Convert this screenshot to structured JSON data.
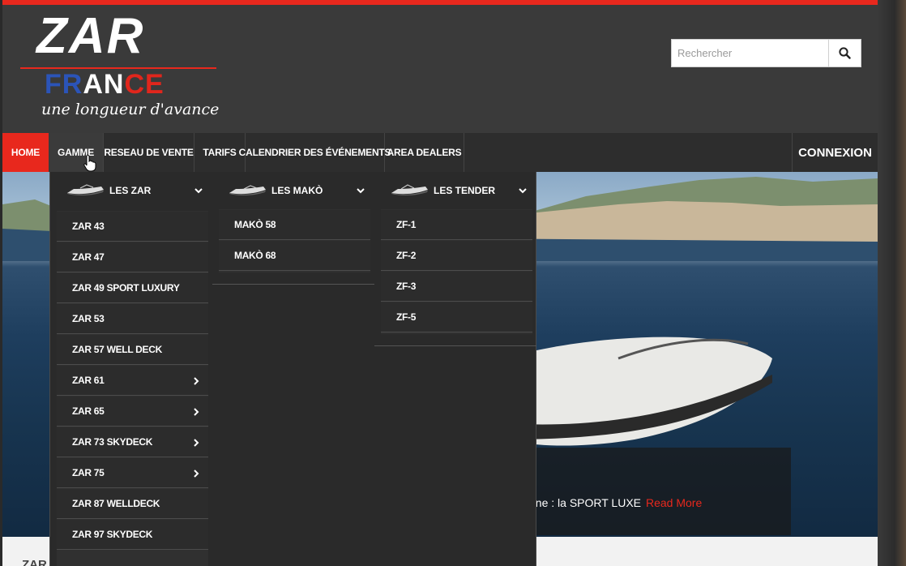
{
  "logo": {
    "zar": "ZAR",
    "france_parts": [
      "FR",
      "AN",
      "CE"
    ],
    "tagline": "une longueur d'avance"
  },
  "search": {
    "placeholder": "Rechercher",
    "icon": "search-icon"
  },
  "nav": {
    "items": [
      "HOME",
      "GAMME",
      "RESEAU DE VENTE",
      "TARIFS",
      "CALENDRIER DES ÉVÉNEMENTS",
      "AREA DEALERS"
    ],
    "login": "CONNEXION",
    "active_color": "#e8281d"
  },
  "mega": {
    "columns": [
      {
        "heading": "LES ZAR",
        "items": [
          {
            "label": "ZAR 43",
            "has_submenu": false
          },
          {
            "label": "ZAR 47",
            "has_submenu": false
          },
          {
            "label": "ZAR 49 SPORT LUXURY",
            "has_submenu": false
          },
          {
            "label": "ZAR 53",
            "has_submenu": false
          },
          {
            "label": "ZAR 57 WELL DECK",
            "has_submenu": false
          },
          {
            "label": "ZAR 61",
            "has_submenu": true
          },
          {
            "label": "ZAR 65",
            "has_submenu": true
          },
          {
            "label": "ZAR 73 SKYDECK",
            "has_submenu": true
          },
          {
            "label": "ZAR 75",
            "has_submenu": true
          },
          {
            "label": "ZAR 87 WELLDECK",
            "has_submenu": false
          },
          {
            "label": "ZAR 97 SKYDECK",
            "has_submenu": false
          }
        ]
      },
      {
        "heading": "LES MAKÒ",
        "items": [
          {
            "label": "MAKÒ 58",
            "has_submenu": false
          },
          {
            "label": "MAKÒ 68",
            "has_submenu": false
          }
        ]
      },
      {
        "heading": "LES TENDER",
        "items": [
          {
            "label": "ZF-1",
            "has_submenu": false
          },
          {
            "label": "ZF-2",
            "has_submenu": false
          },
          {
            "label": "ZF-3",
            "has_submenu": false
          },
          {
            "label": "ZF-5",
            "has_submenu": false
          }
        ]
      }
    ]
  },
  "hero": {
    "caption": "gne : la SPORT LUXE",
    "read_more": "Read More"
  },
  "below": {
    "text": "ZAR"
  }
}
